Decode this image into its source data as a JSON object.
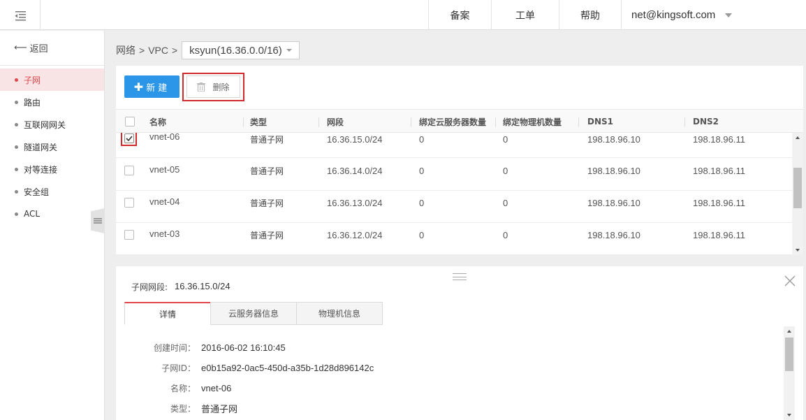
{
  "topbar": {
    "menu_icon": "menu-collapse-icon",
    "nav": {
      "beian": "备案",
      "gongdan": "工单",
      "help": "帮助",
      "user": "net@kingsoft.com"
    }
  },
  "sidebar": {
    "back_label": "返回",
    "items": [
      {
        "label": "子网",
        "active": true
      },
      {
        "label": "路由"
      },
      {
        "label": "互联网网关"
      },
      {
        "label": "隧道网关"
      },
      {
        "label": "对等连接"
      },
      {
        "label": "安全组"
      },
      {
        "label": "ACL"
      }
    ]
  },
  "breadcrumb": {
    "root": "网络",
    "sep": ">",
    "vpc": "VPC",
    "selected": "ksyun(16.36.0.0/16)"
  },
  "toolbar": {
    "new_label": "新建",
    "delete_label": "删除"
  },
  "table": {
    "columns": [
      "名称",
      "类型",
      "网段",
      "绑定云服务器数量",
      "绑定物理机数量",
      "DNS1",
      "DNS2"
    ],
    "rows": [
      {
        "name": "vnet-06",
        "type": "普通子网",
        "cidr": "16.36.15.0/24",
        "vm_count": "0",
        "pm_count": "0",
        "dns1": "198.18.96.10",
        "dns2": "198.18.96.11",
        "checked": true
      },
      {
        "name": "vnet-05",
        "type": "普通子网",
        "cidr": "16.36.14.0/24",
        "vm_count": "0",
        "pm_count": "0",
        "dns1": "198.18.96.10",
        "dns2": "198.18.96.11",
        "checked": false
      },
      {
        "name": "vnet-04",
        "type": "普通子网",
        "cidr": "16.36.13.0/24",
        "vm_count": "0",
        "pm_count": "0",
        "dns1": "198.18.96.10",
        "dns2": "198.18.96.11",
        "checked": false
      },
      {
        "name": "vnet-03",
        "type": "普通子网",
        "cidr": "16.36.12.0/24",
        "vm_count": "0",
        "pm_count": "0",
        "dns1": "198.18.96.10",
        "dns2": "198.18.96.11",
        "checked": false
      }
    ]
  },
  "detail": {
    "summary_label": "子网网段:",
    "summary_value": "16.36.15.0/24",
    "tabs": [
      "详情",
      "云服务器信息",
      "物理机信息"
    ],
    "active_tab": 0,
    "fields": [
      {
        "label": "创建时间：",
        "value": "2016-06-02 16:10:45"
      },
      {
        "label": "子网ID：",
        "value": "e0b15a92-0ac5-450d-a35b-1d28d896142c"
      },
      {
        "label": "名称：",
        "value": "vnet-06"
      },
      {
        "label": "类型：",
        "value": "普通子网"
      }
    ]
  },
  "colors": {
    "primary": "#2b95e8",
    "accent_red": "#e0464b",
    "highlight_box": "#d4292b"
  }
}
